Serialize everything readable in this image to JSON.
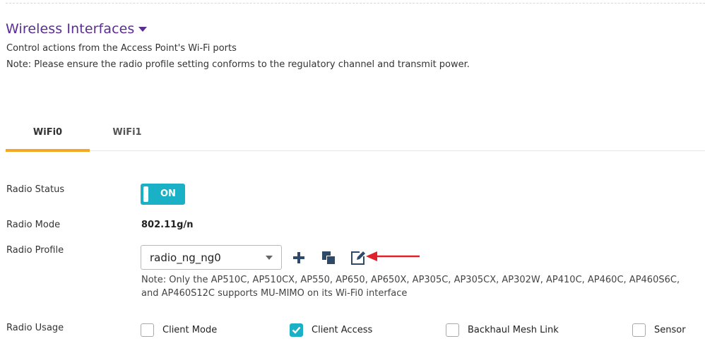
{
  "section": {
    "title": "Wireless Interfaces",
    "description": "Control actions from the Access Point's Wi-Fi ports",
    "note": "Note: Please ensure the radio profile setting conforms to the regulatory channel and transmit power."
  },
  "tabs": [
    {
      "label": "WiFi0",
      "active": true
    },
    {
      "label": "WiFi1",
      "active": false
    }
  ],
  "radio_status": {
    "label": "Radio Status",
    "toggle_text": "ON",
    "enabled": true
  },
  "radio_mode": {
    "label": "Radio Mode",
    "value": "802.11g/n"
  },
  "radio_profile": {
    "label": "Radio Profile",
    "selected": "radio_ng_ng0",
    "note": "Note: Only the AP510C, AP510CX, AP550, AP650, AP650X, AP305C, AP305CX, AP302W, AP410C, AP460C, AP460S6C, and AP460S12C supports MU-MIMO on its Wi-Fi0 interface",
    "actions": [
      "plus-icon",
      "clone-icon",
      "edit-icon"
    ]
  },
  "radio_usage": {
    "label": "Radio Usage",
    "options": [
      {
        "label": "Client Mode",
        "checked": false
      },
      {
        "label": "Client Access",
        "checked": true
      },
      {
        "label": "Backhaul Mesh Link",
        "checked": false
      },
      {
        "label": "Sensor",
        "checked": false
      }
    ]
  },
  "colors": {
    "accent_purple": "#5a2d91",
    "toggle_teal": "#1ab0c6",
    "tab_underline": "#f5a623",
    "icon_navy": "#2d4a6b",
    "annotation_red": "#e0202a"
  }
}
